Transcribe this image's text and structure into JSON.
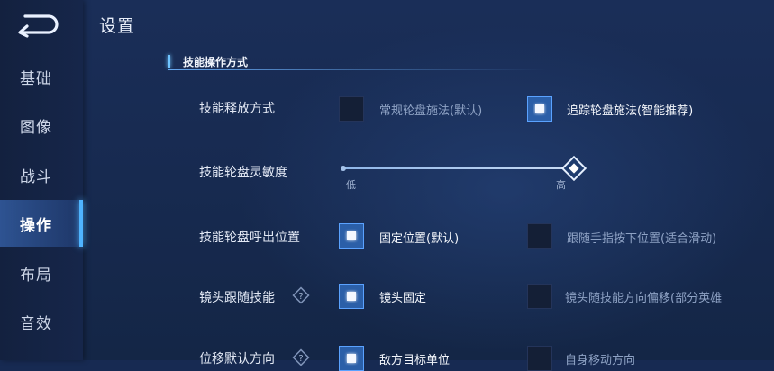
{
  "header": {
    "title": "设置"
  },
  "sidebar": {
    "items": [
      {
        "label": "基础",
        "active": false
      },
      {
        "label": "图像",
        "active": false
      },
      {
        "label": "战斗",
        "active": false
      },
      {
        "label": "操作",
        "active": true
      },
      {
        "label": "布局",
        "active": false
      },
      {
        "label": "音效",
        "active": false
      }
    ]
  },
  "section": {
    "title": "技能操作方式"
  },
  "rows": {
    "release": {
      "label": "技能释放方式",
      "options": [
        {
          "label": "常规轮盘施法(默认)",
          "checked": false
        },
        {
          "label": "追踪轮盘施法(智能推荐)",
          "checked": true
        }
      ]
    },
    "sensitivity": {
      "label": "技能轮盘灵敏度",
      "min_label": "低",
      "max_label": "高",
      "value": 1.0
    },
    "call_position": {
      "label": "技能轮盘呼出位置",
      "options": [
        {
          "label": "固定位置(默认)",
          "checked": true
        },
        {
          "label": "跟随手指按下位置(适合滑动)",
          "checked": false
        }
      ]
    },
    "camera_follow": {
      "label": "镜头跟随技能",
      "options": [
        {
          "label": "镜头固定",
          "checked": true
        },
        {
          "label": "镜头随技能方向偏移(部分英雄",
          "checked": false
        }
      ]
    },
    "displacement": {
      "label": "位移默认方向",
      "options": [
        {
          "label": "敌方目标单位",
          "checked": true
        },
        {
          "label": "自身移动方向",
          "checked": false
        }
      ]
    }
  },
  "colors": {
    "accent": "#4fb4ff",
    "checked_fill": "#2b5fa8",
    "background": "#172a52"
  },
  "icons": {
    "back": "back-arrow-icon",
    "help": "help-diamond-icon",
    "slider_knob": "diamond-knob-icon"
  }
}
